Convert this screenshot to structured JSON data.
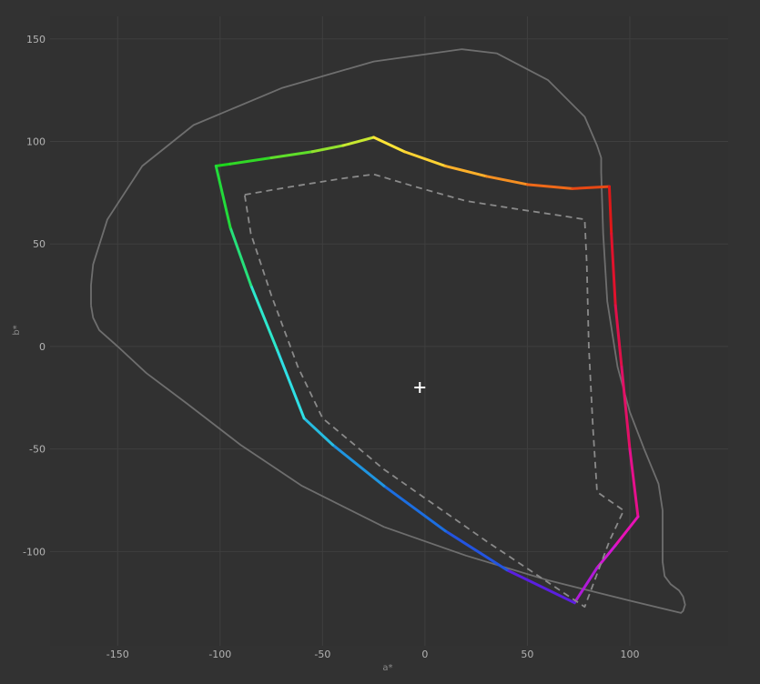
{
  "chart_data": {
    "type": "line",
    "title": "",
    "xlabel": "a*",
    "ylabel": "b*",
    "xlim": [
      -183,
      148
    ],
    "ylim": [
      -146,
      161
    ],
    "x_ticks": [
      -150,
      -100,
      -50,
      0,
      50,
      100
    ],
    "y_ticks": [
      150,
      100,
      50,
      0,
      -50,
      -100
    ],
    "grid": true,
    "colors": {
      "background": "#323232",
      "plot_background": "#313131",
      "grid": "#3f3f3f",
      "outline": "#6e6e6e",
      "reference": "#8a8a8a",
      "white_point": "#ffffff"
    },
    "white_point": {
      "x": -2.5,
      "y": -20
    },
    "series": [
      {
        "style": "outline",
        "points": [
          [
            -163,
            20
          ],
          [
            -162,
            14
          ],
          [
            -159,
            8
          ],
          [
            -150,
            0
          ],
          [
            -136,
            -13
          ],
          [
            -116,
            -28
          ],
          [
            -90,
            -48
          ],
          [
            -60,
            -68
          ],
          [
            -20,
            -88
          ],
          [
            20,
            -102
          ],
          [
            60,
            -114
          ],
          [
            100,
            -124
          ],
          [
            125,
            -130
          ],
          [
            126,
            -129
          ],
          [
            127,
            -126
          ],
          [
            126,
            -122
          ],
          [
            124,
            -119
          ],
          [
            120,
            -116
          ],
          [
            117,
            -112
          ],
          [
            116,
            -105
          ],
          [
            116,
            -80
          ],
          [
            114,
            -67
          ],
          [
            107,
            -50
          ],
          [
            100,
            -32
          ],
          [
            94,
            -10
          ],
          [
            89,
            22
          ],
          [
            87,
            55
          ],
          [
            86,
            85
          ],
          [
            86,
            92
          ],
          [
            84,
            98
          ],
          [
            78,
            112
          ],
          [
            60,
            130
          ],
          [
            35,
            143
          ],
          [
            18,
            145
          ],
          [
            -25,
            139
          ],
          [
            -70,
            126
          ],
          [
            -113,
            108
          ],
          [
            -138,
            88
          ],
          [
            -155,
            62
          ],
          [
            -162,
            40
          ],
          [
            -163,
            30
          ],
          [
            -163,
            20
          ]
        ]
      },
      {
        "style": "gradient",
        "points": [
          [
            -102,
            88
          ],
          [
            -95,
            89
          ],
          [
            -75,
            92
          ],
          [
            -55,
            95
          ],
          [
            -40,
            98
          ],
          [
            -25,
            102
          ],
          [
            -10,
            95
          ],
          [
            10,
            88
          ],
          [
            30,
            83
          ],
          [
            50,
            79
          ],
          [
            72,
            77
          ],
          [
            90,
            78
          ],
          [
            91,
            55
          ],
          [
            93,
            20
          ],
          [
            96,
            -10
          ],
          [
            100,
            -50
          ],
          [
            104,
            -83
          ],
          [
            93,
            -97
          ],
          [
            84,
            -108
          ],
          [
            73,
            -125
          ],
          [
            40,
            -109
          ],
          [
            10,
            -90
          ],
          [
            -20,
            -68
          ],
          [
            -45,
            -48
          ],
          [
            -59,
            -35
          ],
          [
            -72,
            -2
          ],
          [
            -85,
            30
          ],
          [
            -95,
            58
          ],
          [
            -102,
            88
          ]
        ],
        "colors": [
          "#1cd61c",
          "#31d826",
          "#5fde2a",
          "#92e22e",
          "#c8e830",
          "#fde437",
          "#fdd233",
          "#fdb02a",
          "#f58f22",
          "#ee6919",
          "#e74814",
          "#e01818",
          "#e0122c",
          "#e01049",
          "#e21066",
          "#e5108c",
          "#e812b6",
          "#d217d4",
          "#b01ad8",
          "#5a1fe0",
          "#2354e0",
          "#1c6ee0",
          "#1f95e0",
          "#26bce0",
          "#2fdfe4",
          "#2de7cc",
          "#26e07a",
          "#22db3a"
        ]
      },
      {
        "style": "dashed",
        "points": [
          [
            -88,
            74
          ],
          [
            -65,
            78
          ],
          [
            -40,
            82
          ],
          [
            -25,
            84
          ],
          [
            -5,
            78
          ],
          [
            20,
            71
          ],
          [
            45,
            67
          ],
          [
            65,
            64
          ],
          [
            78,
            62
          ],
          [
            79,
            40
          ],
          [
            80,
            0
          ],
          [
            82,
            -40
          ],
          [
            84,
            -71
          ],
          [
            97,
            -80
          ],
          [
            90,
            -95
          ],
          [
            78,
            -127
          ],
          [
            30,
            -95
          ],
          [
            -20,
            -60
          ],
          [
            -50,
            -35
          ],
          [
            -62,
            -10
          ],
          [
            -75,
            25
          ],
          [
            -85,
            55
          ],
          [
            -88,
            74
          ]
        ]
      }
    ]
  }
}
